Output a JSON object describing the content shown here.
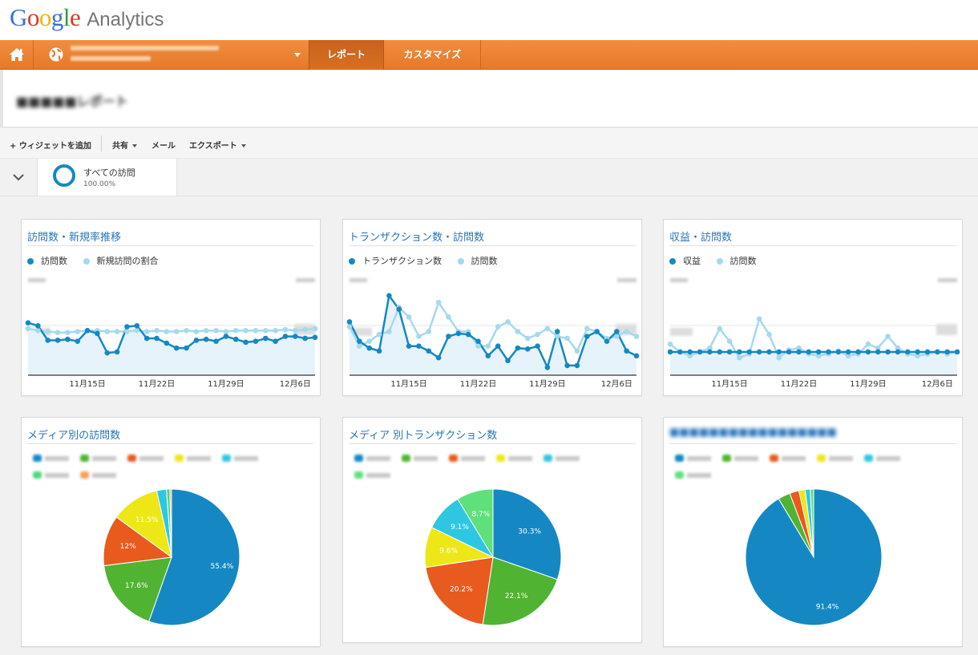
{
  "app": {
    "logo_google": "Google",
    "logo_analytics": "Analytics"
  },
  "nav": {
    "tab_report": "レポート",
    "tab_customize": "カスタマイズ"
  },
  "toolbar": {
    "add_widget": "+ ウィジェットを追加",
    "share": "共有",
    "mail": "メール",
    "export": "エクスポート"
  },
  "segment": {
    "name": "すべての訪問",
    "percent": "100.00%"
  },
  "colors": {
    "brand_orange": "#e98331",
    "link_blue": "#2873b8",
    "dark_series": "#1588c4",
    "light_series": "#a5d9ee"
  },
  "widgets": [
    {
      "title": "訪問数・新規率推移",
      "legend": [
        "訪問数",
        "新規訪問の割合"
      ],
      "chart_data": {
        "type": "line",
        "x_ticks": [
          "11月15日",
          "11月22日",
          "11月29日",
          "12月6日"
        ],
        "series": [
          {
            "name": "訪問数",
            "values": [
              54,
              51,
              36,
              36,
              37,
              35,
              46,
              43,
              23,
              24,
              50,
              51,
              38,
              38,
              33,
              28,
              28,
              36,
              37,
              35,
              40,
              37,
              34,
              35,
              38,
              35,
              40,
              40,
              38,
              39
            ]
          },
          {
            "name": "新規訪問の割合",
            "values": [
              48,
              46,
              45,
              44,
              44,
              45,
              46,
              46,
              45,
              45,
              45,
              46,
              45,
              46,
              45,
              45,
              46,
              45,
              46,
              46,
              45,
              46,
              46,
              46,
              46,
              46,
              47,
              46,
              47,
              48
            ]
          }
        ]
      }
    },
    {
      "title": "トランザクション数・訪問数",
      "legend": [
        "トランザクション数",
        "訪問数"
      ],
      "chart_data": {
        "type": "line",
        "x_ticks": [
          "11月15日",
          "11月22日",
          "11月29日",
          "12月6日"
        ],
        "series": [
          {
            "name": "トランザクション数",
            "values": [
              55,
              35,
              28,
              25,
              82,
              68,
              30,
              30,
              25,
              18,
              40,
              43,
              42,
              35,
              20,
              30,
              15,
              28,
              27,
              30,
              8,
              45,
              10,
              10,
              40,
              45,
              35,
              45,
              25,
              20
            ]
          },
          {
            "name": "訪問数",
            "values": [
              50,
              30,
              35,
              42,
              45,
              70,
              60,
              40,
              45,
              75,
              60,
              45,
              45,
              30,
              30,
              50,
              55,
              45,
              38,
              42,
              48,
              40,
              38,
              25,
              48,
              45,
              38,
              40,
              45,
              40
            ]
          }
        ]
      }
    },
    {
      "title": "収益・訪問数",
      "legend": [
        "収益",
        "訪問数"
      ],
      "chart_data": {
        "type": "line",
        "x_ticks": [
          "11月15日",
          "11月22日",
          "11月29日",
          "12月6日"
        ],
        "series": [
          {
            "name": "収益",
            "values": [
              24,
              24,
              24,
              24,
              24,
              24,
              24,
              24,
              24,
              24,
              24,
              24,
              24,
              24,
              24,
              24,
              24,
              24,
              24,
              24,
              24,
              24,
              24,
              24,
              24,
              24,
              24,
              24,
              24,
              24
            ]
          },
          {
            "name": "訪問数",
            "values": [
              32,
              24,
              20,
              24,
              28,
              48,
              35,
              18,
              22,
              58,
              42,
              18,
              26,
              28,
              22,
              20,
              22,
              25,
              20,
              22,
              32,
              28,
              40,
              28,
              22,
              20,
              22,
              24,
              22,
              24
            ]
          }
        ]
      }
    },
    {
      "title": "メディア別の訪問数",
      "chart_data": {
        "type": "pie",
        "series": [
          {
            "values": [
              55.4,
              17.6,
              12,
              11.5,
              2.3,
              0.8,
              0.4
            ]
          }
        ],
        "value_labels": [
          "55.4%",
          "17.6%",
          "12%",
          "11.5%"
        ],
        "colors": [
          "#1588c4",
          "#50b332",
          "#e85a1e",
          "#ede717",
          "#2ec7e2",
          "#4fd57a",
          "#f0a060"
        ]
      }
    },
    {
      "title": "メディア 別トランザクション数",
      "chart_data": {
        "type": "pie",
        "series": [
          {
            "values": [
              30.3,
              22.1,
              20.2,
              9.6,
              9.1,
              8.7
            ]
          }
        ],
        "value_labels": [
          "30.3%",
          "22.1%",
          "20.2%",
          "9.6%",
          "9.1%",
          "8.7%"
        ],
        "colors": [
          "#1588c4",
          "#50b332",
          "#e85a1e",
          "#ede717",
          "#2ec7e2",
          "#5fe07a"
        ]
      }
    },
    {
      "chart_data": {
        "type": "pie",
        "series": [
          {
            "values": [
              91.4,
              2.9,
              2.2,
              1.5,
              1.2,
              0.8
            ]
          }
        ],
        "value_labels": [
          "91.4%"
        ],
        "colors": [
          "#1588c4",
          "#50b332",
          "#e85a1e",
          "#ede717",
          "#2ec7e2",
          "#5fe07a"
        ]
      }
    }
  ]
}
